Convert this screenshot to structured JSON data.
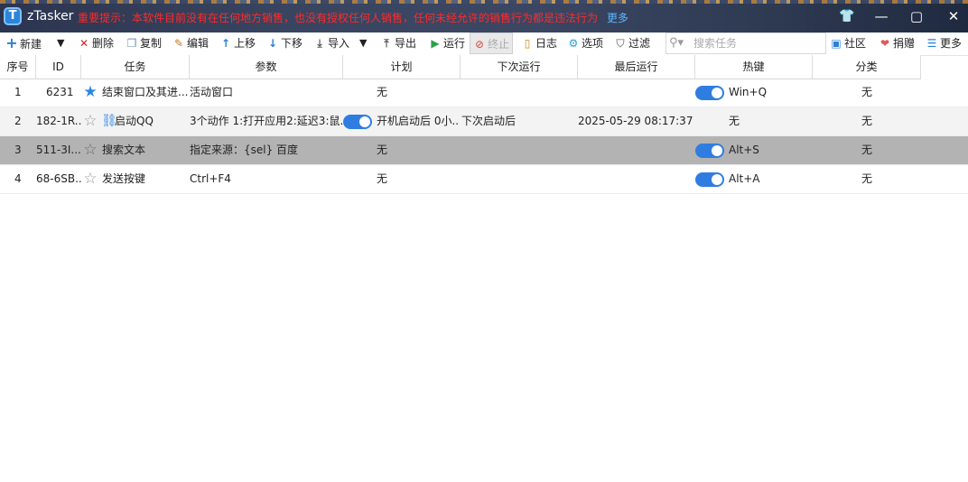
{
  "titlebar": {
    "logo_letter": "T",
    "app_name": "zTasker",
    "notice": "重要提示：本软件目前没有在任何地方销售，也没有授权任何人销售，任何未经允许的销售行为都是违法行为",
    "more": "更多",
    "shirt_icon": "👕",
    "minimize": "—",
    "maximize": "▢",
    "close": "✕"
  },
  "toolbar": {
    "new": "新建",
    "new_dropdown": "▼",
    "delete": "删除",
    "copy": "复制",
    "edit": "编辑",
    "move_up": "上移",
    "move_down": "下移",
    "import": "导入",
    "import_dropdown": "▼",
    "export": "导出",
    "run": "运行",
    "stop": "终止",
    "log": "日志",
    "options": "选项",
    "filter": "过滤",
    "search_placeholder": "搜索任务",
    "community": "社区",
    "donate": "捐赠",
    "more": "更多"
  },
  "columns": [
    "序号",
    "ID",
    "任务",
    "参数",
    "计划",
    "下次运行",
    "最后运行",
    "热键",
    "分类"
  ],
  "rows": [
    {
      "index": "1",
      "id": "6231",
      "starred": true,
      "task": "结束窗口及其进...",
      "params": "活动窗口",
      "param_toggle": false,
      "plan": "无",
      "next_run": "",
      "last_run": "",
      "hotkey_toggle": true,
      "hotkey": "Win+Q",
      "category": "无"
    },
    {
      "index": "2",
      "id": "182-1R...",
      "starred": false,
      "linked": true,
      "task": "启动QQ",
      "params": "3个动作 1:打开应用2:延迟3:鼠...",
      "param_toggle": true,
      "plan": "开机启动后 0小...",
      "next_run": "下次启动后",
      "last_run": "2025-05-29 08:17:37",
      "hotkey_toggle": false,
      "hotkey": "无",
      "category": "无"
    },
    {
      "index": "3",
      "id": "511-3I...",
      "starred": false,
      "task": "搜索文本",
      "params": "指定来源：{sel} 百度",
      "param_toggle": false,
      "plan": "无",
      "next_run": "",
      "last_run": "",
      "hotkey_toggle": true,
      "hotkey": "Alt+S",
      "category": "无"
    },
    {
      "index": "4",
      "id": "68-6SB...",
      "starred": false,
      "task": "发送按键",
      "params": "Ctrl+F4",
      "param_toggle": false,
      "plan": "无",
      "next_run": "",
      "last_run": "",
      "hotkey_toggle": true,
      "hotkey": "Alt+A",
      "category": "无"
    }
  ],
  "colors": {
    "accent": "#2f7de1",
    "notice": "#ff2a2a",
    "selected_row": "#b3b3b3"
  }
}
